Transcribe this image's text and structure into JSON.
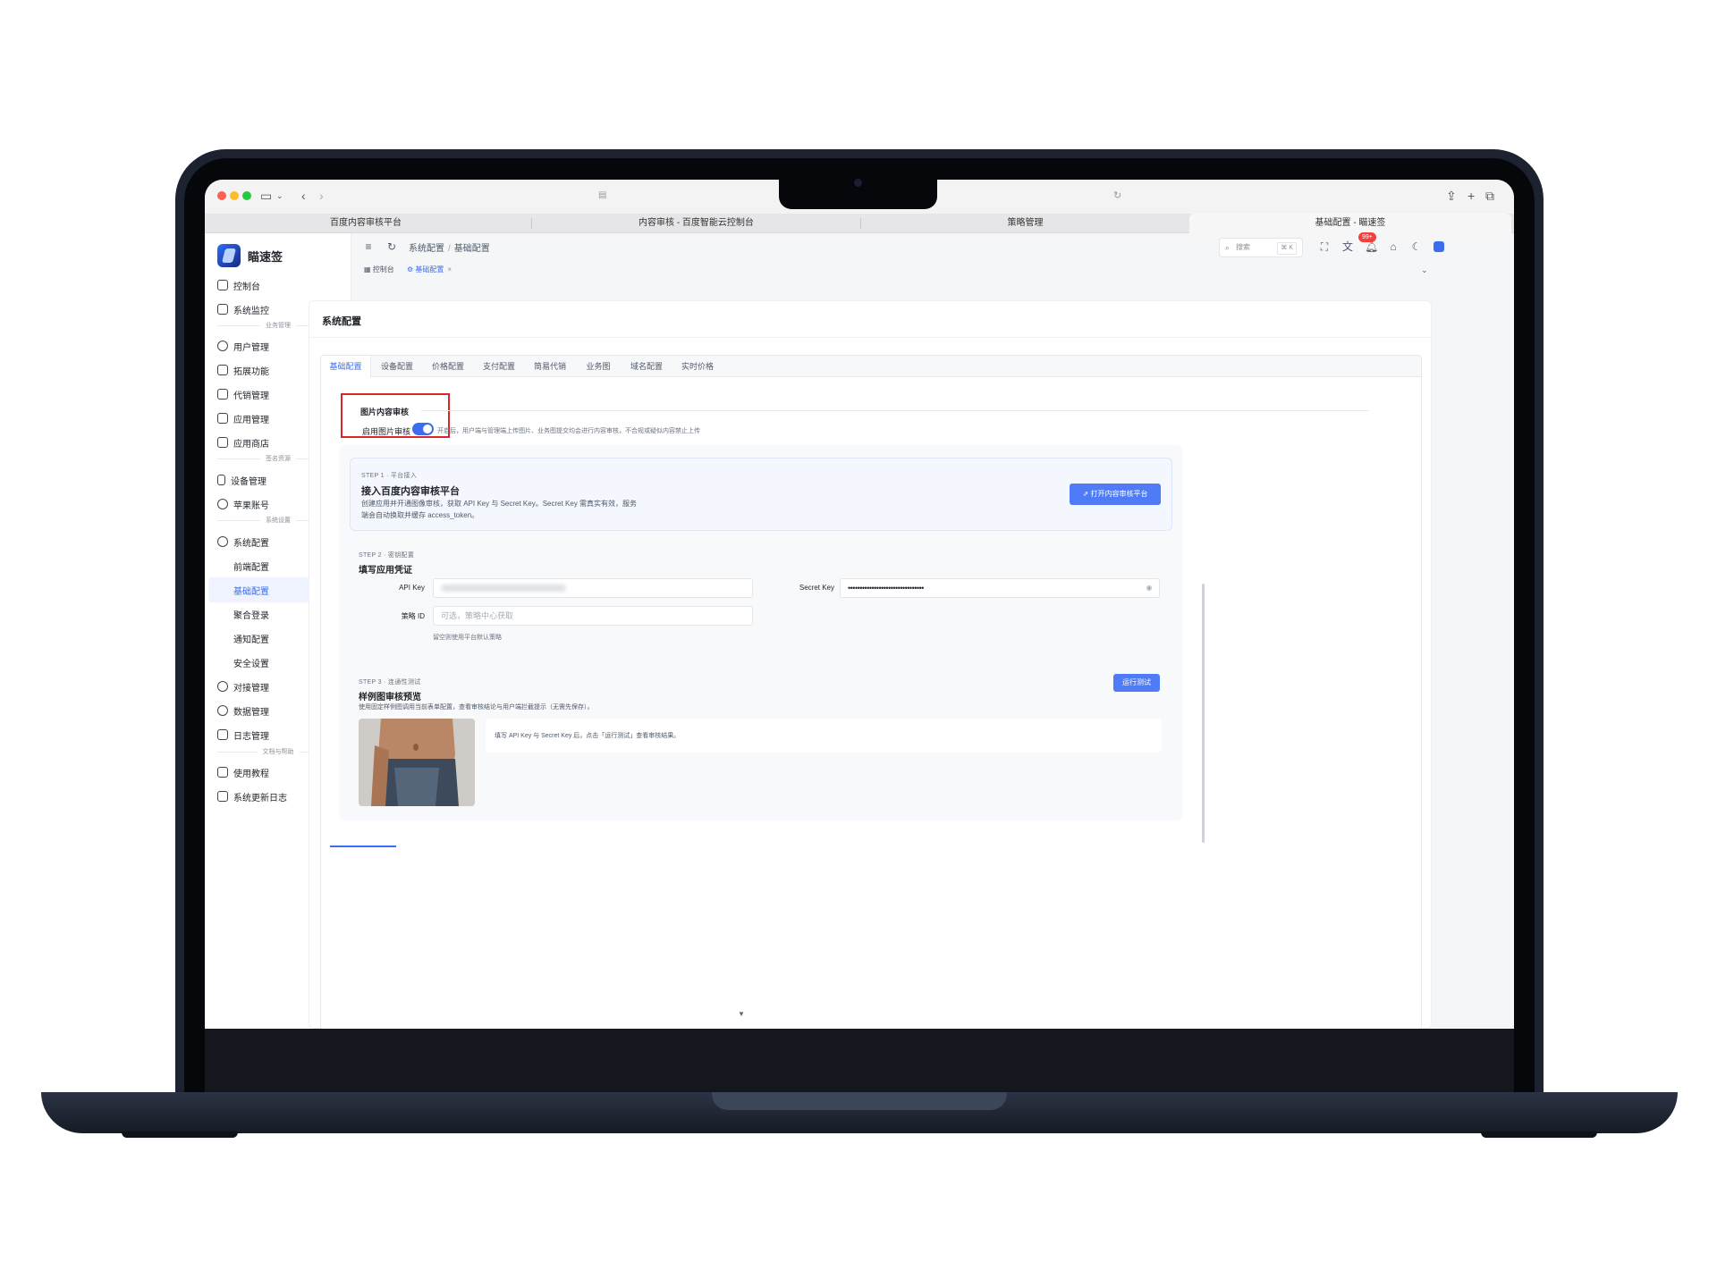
{
  "browser": {
    "tabs": [
      {
        "label": "百度内容审核平台",
        "active": false
      },
      {
        "label": "内容审核 - 百度智能云控制台",
        "active": false
      },
      {
        "label": "策略管理",
        "active": false
      },
      {
        "label": "基础配置 - 瞄速签",
        "active": true
      }
    ]
  },
  "brand": {
    "name": "瞄速签"
  },
  "sidebar": {
    "items": [
      {
        "label": "控制台"
      },
      {
        "label": "系统监控"
      },
      {
        "group": "业务管理"
      },
      {
        "label": "用户管理"
      },
      {
        "label": "拓展功能"
      },
      {
        "label": "代销管理"
      },
      {
        "label": "应用管理"
      },
      {
        "label": "应用商店"
      },
      {
        "group": "签名资源"
      },
      {
        "label": "设备管理"
      },
      {
        "label": "苹果账号"
      },
      {
        "group": "系统设置"
      },
      {
        "label": "系统配置"
      },
      {
        "sub": "前端配置"
      },
      {
        "sub": "基础配置"
      },
      {
        "sub": "聚合登录"
      },
      {
        "sub": "通知配置"
      },
      {
        "sub": "安全设置"
      },
      {
        "label": "对接管理"
      },
      {
        "label": "数据管理"
      },
      {
        "label": "日志管理"
      },
      {
        "group": "文档与帮助"
      },
      {
        "label": "使用教程"
      },
      {
        "label": "系统更新日志"
      }
    ]
  },
  "header": {
    "breadcrumb": [
      "系统配置",
      "基础配置"
    ],
    "search_placeholder": "搜索",
    "search_kbd": "⌘ K",
    "notification_badge": "99+"
  },
  "page_tabs": [
    {
      "label": "控制台",
      "active": false
    },
    {
      "label": "基础配置",
      "active": true
    }
  ],
  "card": {
    "title": "系统配置",
    "tabs": [
      "基础配置",
      "设备配置",
      "价格配置",
      "支付配置",
      "简易代销",
      "业务图",
      "域名配置",
      "实时价格"
    ],
    "active_tab": "基础配置"
  },
  "section": {
    "title": "图片内容审核",
    "switch_label": "启用图片审核",
    "switch_on": true,
    "switch_help": "开启后，用户端与管理端上传图片、业务图提交均会进行内容审核，不合规或疑似内容禁止上传"
  },
  "step1": {
    "eyebrow": "STEP 1 · 平台接入",
    "title": "接入百度内容审核平台",
    "desc_line1": "创建应用并开通图像审核，获取 API Key 与 Secret Key。Secret Key 需真实有效，服务",
    "desc_line2": "端会自动换取并缓存 access_token。",
    "button": "打开内容审核平台"
  },
  "step2": {
    "eyebrow": "STEP 2 · 密钥配置",
    "title": "填写应用凭证",
    "api_key_label": "API Key",
    "secret_key_label": "Secret Key",
    "secret_key_value": "••••••••••••••••••••••••••••••••",
    "policy_label": "策略 ID",
    "policy_placeholder": "可选，策略中心获取",
    "policy_hint": "留空则使用平台默认策略"
  },
  "step3": {
    "eyebrow": "STEP 3 · 连通性测试",
    "title": "样例图审核预览",
    "desc": "使用固定样例图调用当前表单配置，查看审核结论与用户端拦截提示（无需先保存）。",
    "button": "运行测试",
    "result_text": "填写 API Key 与 Secret Key 后，点击「运行测试」查看审核结果。"
  },
  "colors": {
    "accent": "#3b6df2",
    "button": "#4f7cf6",
    "highlight_box": "#d9262a",
    "badge": "#f53f3f"
  }
}
